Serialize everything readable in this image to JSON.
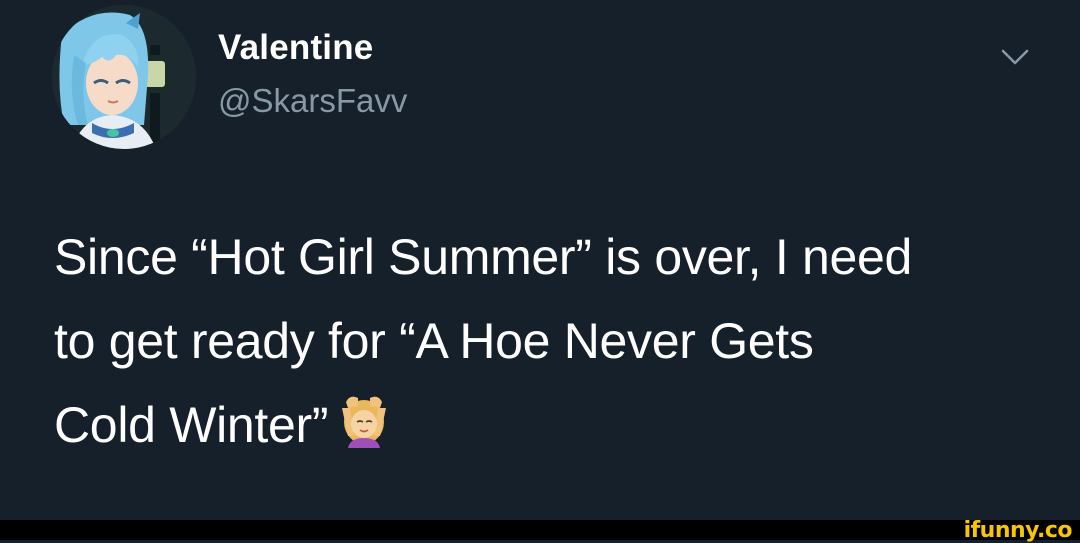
{
  "tweet": {
    "author": {
      "display_name": "Valentine",
      "handle": "@SkarsFavv",
      "avatar_icon": "anime-character-avatar"
    },
    "menu_icon": "chevron-down-icon",
    "text_lines": [
      "Since “Hot Girl Summer” is over, I need",
      "to get ready for “A Hoe Never Gets",
      "Cold Winter”"
    ],
    "emoji": "face-massage-emoji",
    "colors": {
      "background": "#15202b",
      "text": "#ffffff",
      "secondary_text": "#8899a6"
    }
  },
  "watermark": {
    "text": "ifunny.co",
    "color": "#f7c600"
  }
}
